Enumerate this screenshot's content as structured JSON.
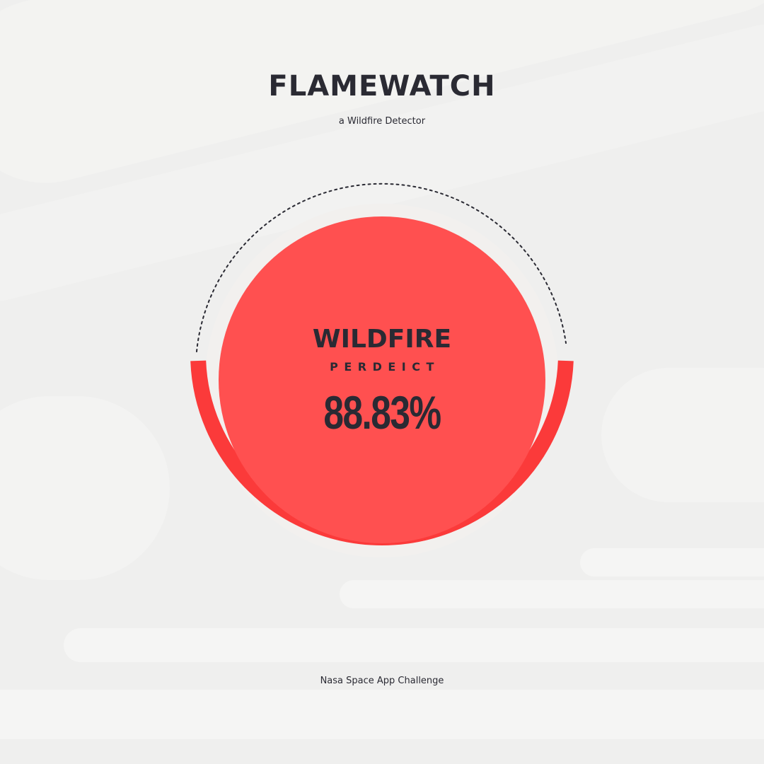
{
  "header": {
    "title": "FLAMEWATCH",
    "subtitle": "a Wildfire Detector"
  },
  "gauge": {
    "label": "WILDFIRE",
    "sublabel": "PERDEICT",
    "value_text": "88.83%",
    "value_percent": 88.83,
    "colors": {
      "disc": "#ff5050",
      "arc": "#fb3a3a",
      "ring_gap": "#f2f0ee",
      "dotted_track": "#2a2a33",
      "text": "#2a2a33"
    }
  },
  "footer": {
    "text": "Nasa Space App Challenge"
  }
}
